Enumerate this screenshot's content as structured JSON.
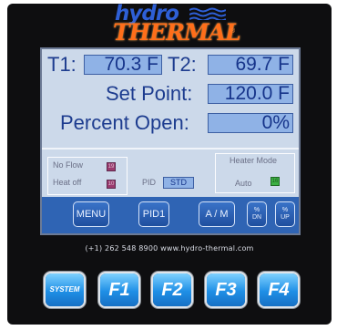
{
  "brand": {
    "line1": "hydro",
    "line2": "THERMAL",
    "registered": "®"
  },
  "readings": {
    "t1_label": "T1:",
    "t1_value": "70.3 F",
    "t2_label": "T2:",
    "t2_value": "69.7 F",
    "setpoint_label": "Set Point:",
    "setpoint_value": "120.0 F",
    "percent_label": "Percent Open:",
    "percent_value": "0%"
  },
  "status": {
    "no_flow_label": "No Flow",
    "no_flow_indicator": "19",
    "heat_off_label": "Heat off",
    "heat_off_indicator": "10",
    "pid_label": "PID",
    "pid_mode": "STD",
    "heater_mode_label": "Heater Mode",
    "heater_mode_value": "Auto",
    "heater_indicator": "16"
  },
  "screen_buttons": {
    "menu": "MENU",
    "pid1": "PID1",
    "am": "A / M",
    "pct_dn_top": "%",
    "pct_dn_bottom": "DN",
    "pct_up_top": "%",
    "pct_up_bottom": "UP"
  },
  "contact": "(+1) 262 548 8900  www.hydro-thermal.com",
  "function_keys": {
    "system": "SYSTEM",
    "f1": "F1",
    "f2": "F2",
    "f3": "F3",
    "f4": "F4"
  },
  "colors": {
    "screen_bg": "#ccd9ea",
    "value_box": "#8fb2e6",
    "button_bar": "#2f64b4",
    "text_blue": "#1d3c8f",
    "fkey_blue": "#1f8fe6",
    "logo_blue": "#2e5fd6",
    "logo_orange": "#ff6e1a"
  }
}
